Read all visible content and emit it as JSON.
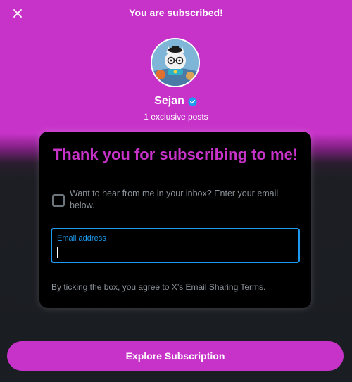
{
  "header": {
    "title": "You are subscribed!",
    "close_icon": "close-icon"
  },
  "creator": {
    "name": "Sejan",
    "posts_label": "1 exclusive posts",
    "verified_icon": "verified-badge-icon",
    "verified_color": "#1d9bf0"
  },
  "card": {
    "title": "Thank you for subscribing to me!",
    "checkbox_label": "Want to hear from me in your inbox? Enter your email below.",
    "checkbox_checked": false,
    "email": {
      "label": "Email address",
      "value": ""
    },
    "terms": "By ticking the box, you agree to X’s Email Sharing Terms."
  },
  "cta": {
    "label": "Explore Subscription"
  },
  "colors": {
    "accent": "#c733c9",
    "focus": "#1d9bf0",
    "card_bg": "#000000"
  }
}
